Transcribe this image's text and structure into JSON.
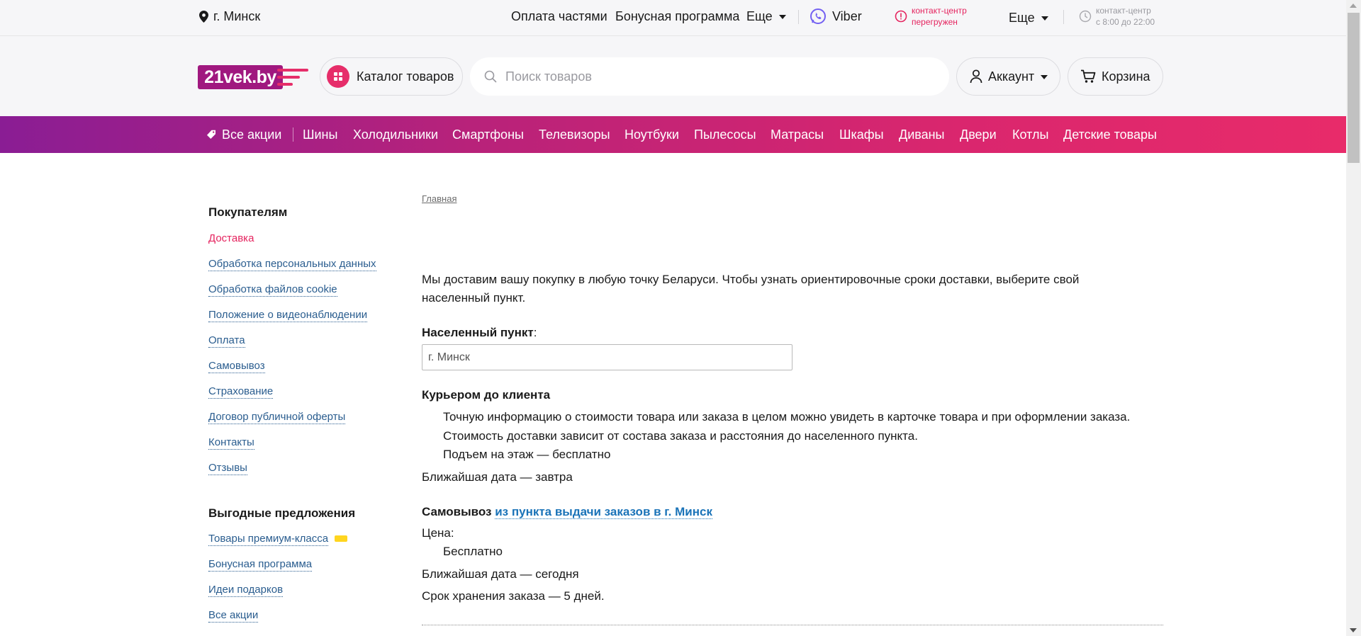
{
  "topbar": {
    "city": "г. Минск",
    "installments": "Оплата частями",
    "bonus": "Бонусная программа",
    "more1": "Еще",
    "viber": "Viber",
    "contact_alert_line1": "контакт-центр",
    "contact_alert_line2": "перегружен",
    "more2": "Еще",
    "hours_line1": "контакт-центр",
    "hours_line2": "с 8:00 до 22:00"
  },
  "header": {
    "logo_text": "21vek.by",
    "catalog": "Каталог товаров",
    "search_placeholder": "Поиск товаров",
    "account": "Аккаунт",
    "cart": "Корзина"
  },
  "catnav": {
    "all_promos": "Все акции",
    "items": [
      "Шины",
      "Холодильники",
      "Смартфоны",
      "Телевизоры",
      "Ноутбуки",
      "Пылесосы",
      "Матрасы",
      "Шкафы",
      "Диваны",
      "Двери",
      "Котлы",
      "Детские товары"
    ]
  },
  "sidebar": {
    "buyers_title": "Покупателям",
    "buyers_links": [
      "Доставка",
      "Обработка персональных данных",
      "Обработка файлов cookie",
      "Положение о видеонаблюдении",
      "Оплата",
      "Самовывоз",
      "Страхование",
      "Договор публичной оферты",
      "Контакты",
      "Отзывы"
    ],
    "offers_title": "Выгодные предложения",
    "offers_links": [
      "Товары премиум-класса",
      "Бонусная программа",
      "Идеи подарков",
      "Все акции"
    ]
  },
  "main": {
    "breadcrumb": "Главная",
    "intro": "Мы доставим вашу покупку в любую точку Беларуси. Чтобы узнать ориентировочные сроки доставки, выберите свой населенный пункт.",
    "locality_label": "Населенный пункт",
    "locality_colon": ":",
    "locality_value": "г. Минск",
    "courier_title": "Курьером до клиента",
    "courier_line1": "Точную информацию о стоимости товара или заказа в целом можно увидеть в карточке товара и при оформлении заказа.",
    "courier_line2": "Стоимость доставки зависит от состава заказа и расстояния до населенного пункта.",
    "courier_line3": "Подъем на этаж — бесплатно",
    "courier_nearest": "Ближайшая дата — завтра",
    "pickup_title": "Самовывоз",
    "pickup_link": "из пункта выдачи заказов в г. Минск",
    "price_label": "Цена:",
    "price_value": "Бесплатно",
    "pickup_nearest": "Ближайшая дата — сегодня",
    "storage": "Срок хранения заказа — 5 дней."
  },
  "colors": {
    "accent": "#e62e6a",
    "brand_purple": "#a0187f",
    "link": "#2a5d8f",
    "active_link": "#e5245f",
    "premium_badge": "#ffd51f"
  }
}
